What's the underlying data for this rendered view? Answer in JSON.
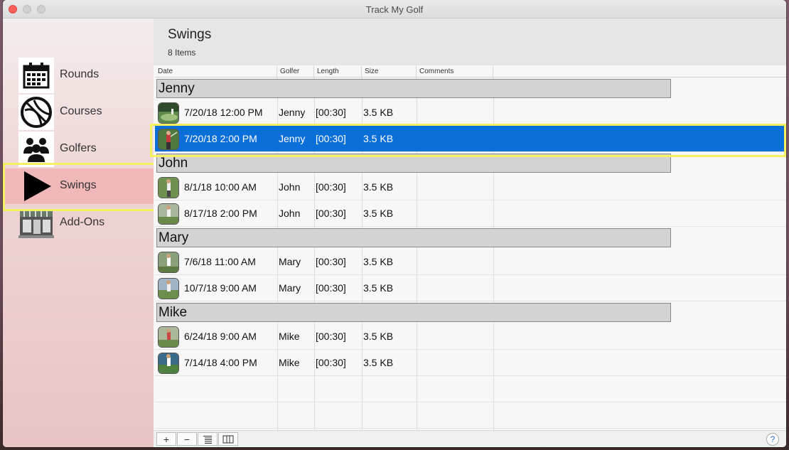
{
  "window": {
    "title": "Track My Golf"
  },
  "sidebar": {
    "items": [
      {
        "label": "Rounds",
        "icon": "calendar-icon"
      },
      {
        "label": "Courses",
        "icon": "globe-icon"
      },
      {
        "label": "Golfers",
        "icon": "group-icon"
      },
      {
        "label": "Swings",
        "icon": "play-icon",
        "active": true
      },
      {
        "label": "Add-Ons",
        "icon": "store-icon"
      }
    ]
  },
  "header": {
    "title": "Swings",
    "count": "8 Items"
  },
  "table": {
    "columns": [
      "Date",
      "Golfer",
      "Length",
      "Size",
      "Comments"
    ],
    "groups": [
      {
        "name": "Jenny",
        "rows": [
          {
            "date": "7/20/18 12:00 PM",
            "golfer": "Jenny",
            "length": "[00:30]",
            "size": "3.5 KB",
            "comments": ""
          },
          {
            "date": "7/20/18 2:00 PM",
            "golfer": "Jenny",
            "length": "[00:30]",
            "size": "3.5 KB",
            "comments": "",
            "selected": true
          }
        ]
      },
      {
        "name": "John",
        "rows": [
          {
            "date": "8/1/18 10:00 AM",
            "golfer": "John",
            "length": "[00:30]",
            "size": "3.5 KB",
            "comments": ""
          },
          {
            "date": "8/17/18 2:00 PM",
            "golfer": "John",
            "length": "[00:30]",
            "size": "3.5 KB",
            "comments": ""
          }
        ]
      },
      {
        "name": "Mary",
        "rows": [
          {
            "date": "7/6/18 11:00 AM",
            "golfer": "Mary",
            "length": "[00:30]",
            "size": "3.5 KB",
            "comments": ""
          },
          {
            "date": "10/7/18 9:00 AM",
            "golfer": "Mary",
            "length": "[00:30]",
            "size": "3.5 KB",
            "comments": ""
          }
        ]
      },
      {
        "name": "Mike",
        "rows": [
          {
            "date": "6/24/18 9:00 AM",
            "golfer": "Mike",
            "length": "[00:30]",
            "size": "3.5 KB",
            "comments": ""
          },
          {
            "date": "7/14/18 4:00 PM",
            "golfer": "Mike",
            "length": "[00:30]",
            "size": "3.5 KB",
            "comments": ""
          }
        ]
      }
    ]
  },
  "toolbar": {
    "add": "+",
    "remove": "−",
    "help": "?"
  },
  "colors": {
    "selection": "#0a6fd8",
    "highlight": "#f4f060",
    "active_nav": "#f0b8b8"
  }
}
